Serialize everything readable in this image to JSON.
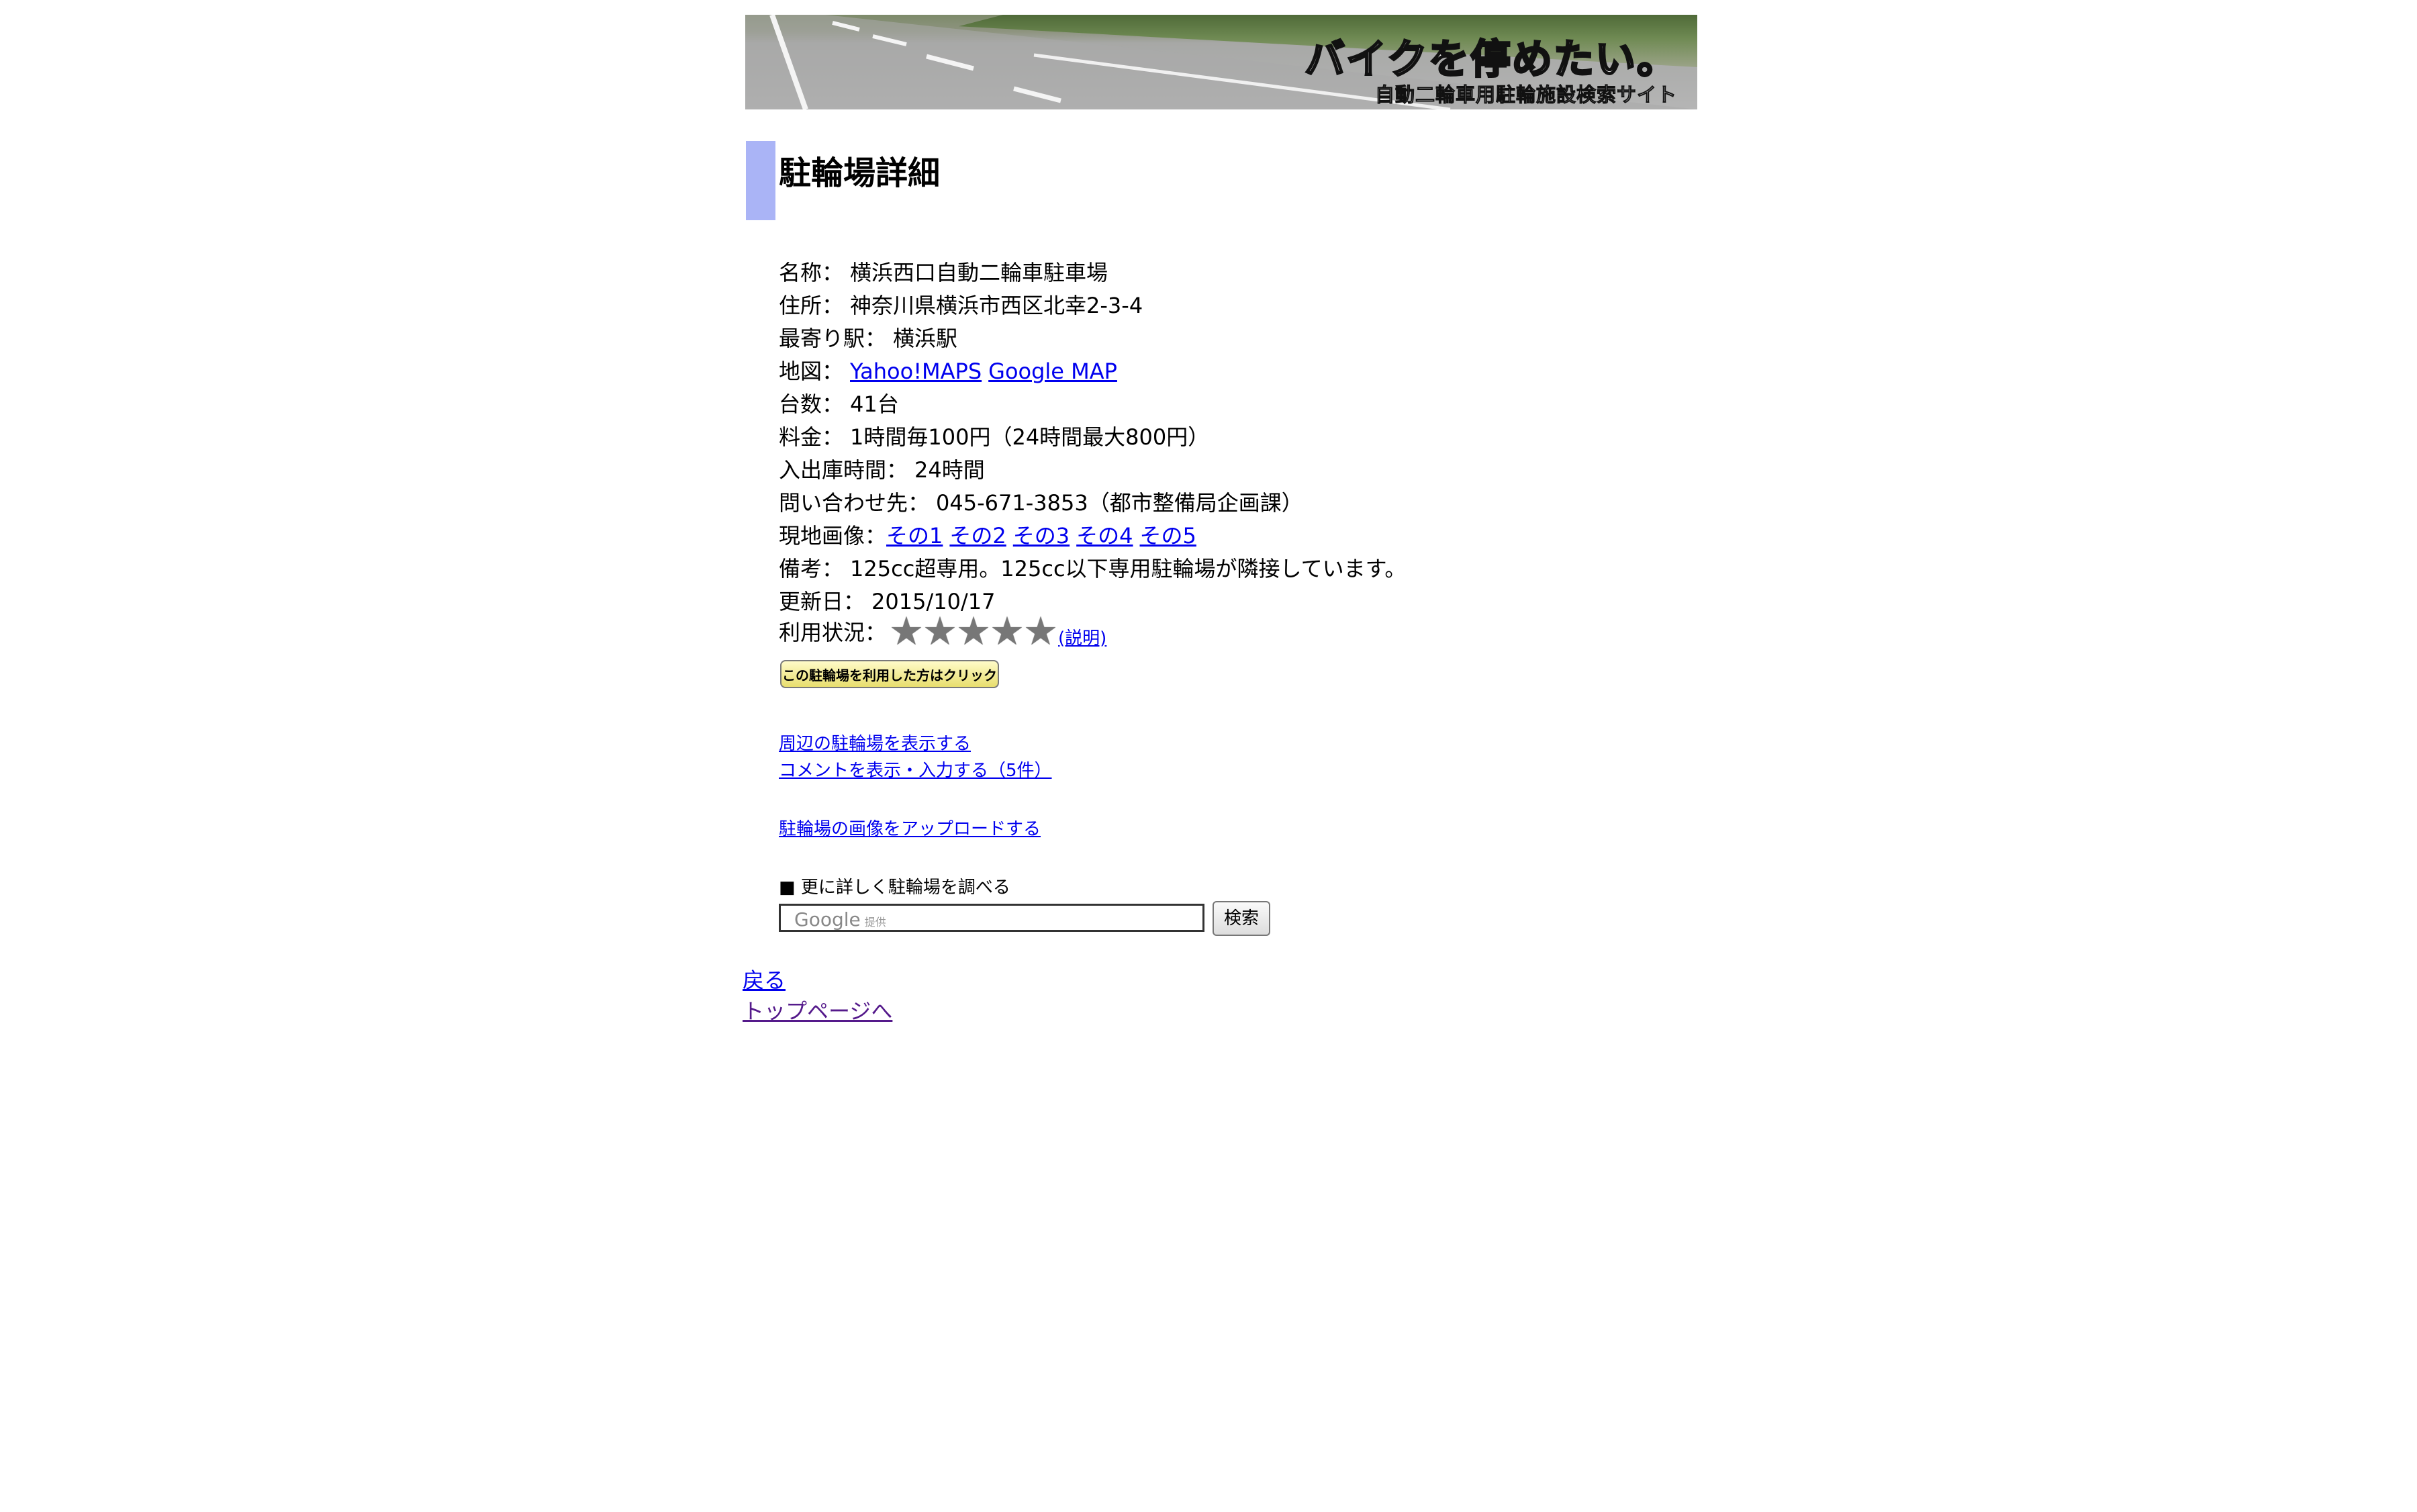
{
  "banner": {
    "title": "バイクを停めたい。",
    "subtitle": "自動二輪車用駐輪施設検索サイト"
  },
  "heading": "駐輪場詳細",
  "details": {
    "name_label": "名称：",
    "name": "横浜西口自動二輪車駐車場",
    "address_label": "住所：",
    "address": "神奈川県横浜市西区北幸2-3-4",
    "station_label": "最寄り駅：",
    "station": "横浜駅",
    "map_label": "地図：",
    "map_link_yahoo": "Yahoo!MAPS",
    "map_link_google": "Google MAP",
    "capacity_label": "台数：",
    "capacity": "41台",
    "fee_label": "料金：",
    "fee": "1時間毎100円（24時間最大800円）",
    "hours_label": "入出庫時間：",
    "hours": "24時間",
    "contact_label": "問い合わせ先：",
    "contact": "045-671-3853（都市整備局企画課）",
    "images_label": "現地画像：",
    "images": [
      "その1",
      "その2",
      "その3",
      "その4",
      "その5"
    ],
    "note_label": "備考：",
    "note": "125cc超専用。125cc以下専用駐輪場が隣接しています。",
    "updated_label": "更新日：",
    "updated": "2015/10/17"
  },
  "status": {
    "label": "利用状況：",
    "stars_filled": 0,
    "stars_total": 5,
    "star_icon": "star-icon",
    "explain_link": "(説明)",
    "use_button": "この駐輪場を利用した方はクリック"
  },
  "links": {
    "nearby": "周辺の駐輪場を表示する",
    "comments": "コメントを表示・入力する（5件）",
    "upload": "駐輪場の画像をアップロードする"
  },
  "search": {
    "label": "■ 更に詳しく駐輪場を調べる",
    "placeholder_brand": "Google",
    "placeholder_suffix": "提供",
    "button": "検索"
  },
  "footer": {
    "back": "戻る",
    "top": "トップページへ"
  },
  "colors": {
    "heading_bar": "#aab4f6",
    "link": "#0000ee",
    "visited_link": "#551a8b",
    "star": "#777777"
  }
}
